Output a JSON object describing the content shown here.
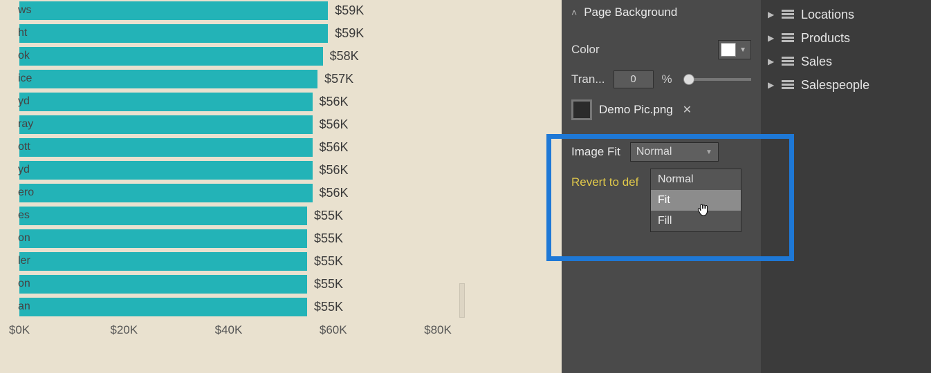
{
  "chart_data": {
    "type": "bar",
    "orientation": "horizontal",
    "categories": [
      "ws",
      "ht",
      "ok",
      "ice",
      "yd",
      "ray",
      "ott",
      "yd",
      "ero",
      "es",
      "on",
      "ler",
      "on",
      "an"
    ],
    "values": [
      59,
      59,
      58,
      57,
      56,
      56,
      56,
      56,
      56,
      55,
      55,
      55,
      55,
      55
    ],
    "value_labels": [
      "$59K",
      "$59K",
      "$58K",
      "$57K",
      "$56K",
      "$56K",
      "$56K",
      "$56K",
      "$56K",
      "$55K",
      "$55K",
      "$55K",
      "$55K",
      "$55K"
    ],
    "xlabel": "",
    "ylabel": "",
    "xlim": [
      0,
      80
    ],
    "x_ticks": [
      0,
      20,
      40,
      60,
      80
    ],
    "x_tick_labels": [
      "$0K",
      "$20K",
      "$40K",
      "$60K",
      "$80K"
    ],
    "bar_color": "#23b3b7"
  },
  "format_pane": {
    "section": "Page Background",
    "color_label": "Color",
    "color_value": "#ffffff",
    "transparency_label": "Tran...",
    "transparency_value": "0",
    "transparency_unit": "%",
    "image_name": "Demo Pic.png",
    "image_fit_label": "Image Fit",
    "image_fit_value": "Normal",
    "image_fit_options": [
      "Normal",
      "Fit",
      "Fill"
    ],
    "revert": "Revert to def"
  },
  "fields": {
    "items": [
      "Locations",
      "Products",
      "Sales",
      "Salespeople"
    ]
  }
}
